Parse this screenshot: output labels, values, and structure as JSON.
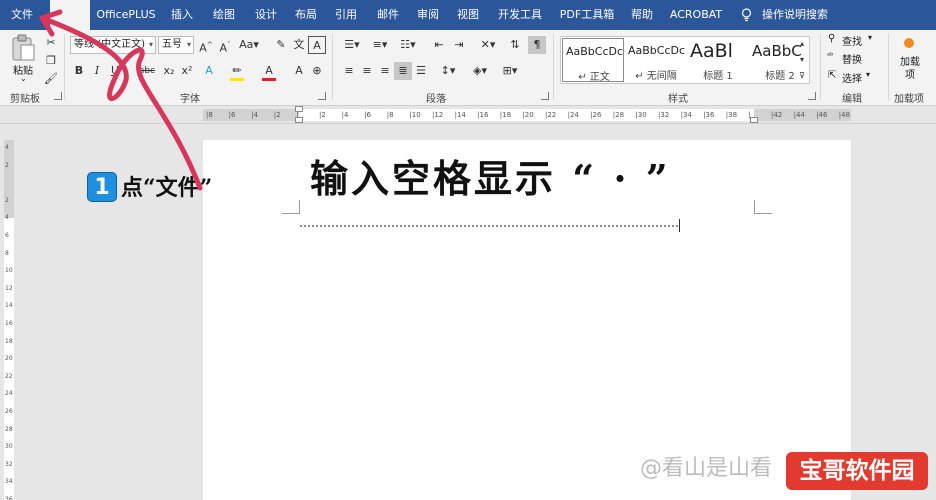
{
  "ribbon_tabs": [
    "文件",
    "",
    "OfficePLUS",
    "插入",
    "绘图",
    "设计",
    "布局",
    "引用",
    "邮件",
    "审阅",
    "视图",
    "开发工具",
    "PDF工具箱",
    "帮助",
    "ACROBAT",
    "操作说明搜索"
  ],
  "clipboard": {
    "paste_label": "粘贴",
    "group_label": "剪贴板"
  },
  "font": {
    "font_name": "等线 (中文正文)",
    "font_size": "五号",
    "group_label": "字体",
    "buttons": [
      "B",
      "I",
      "U",
      "abc",
      "x₂",
      "x²",
      "A",
      "A"
    ]
  },
  "paragraph": {
    "group_label": "段落"
  },
  "styles": {
    "group_label": "样式",
    "items": [
      {
        "sample": "AaBbCcDc",
        "name": "↵ 正文"
      },
      {
        "sample": "AaBbCcDc",
        "name": "↵ 无间隔"
      },
      {
        "sample": "AaBl",
        "name": "标题 1"
      },
      {
        "sample": "AaBbC",
        "name": "标题 2"
      }
    ]
  },
  "editing": {
    "find": "查找",
    "replace": "替换",
    "select": "选择",
    "group_label": "编辑"
  },
  "addins": {
    "label": "加载项",
    "group_label": "加载项"
  },
  "ruler": {
    "h_ticks": [
      "8",
      "6",
      "4",
      "2",
      "",
      "2",
      "4",
      "6",
      "8",
      "10",
      "12",
      "14",
      "16",
      "18",
      "20",
      "22",
      "24",
      "26",
      "28",
      "30",
      "32",
      "34",
      "36",
      "38",
      "",
      "42",
      "44",
      "46",
      "48"
    ],
    "v_ticks": [
      "4",
      "2",
      "",
      "2",
      "4",
      "6",
      "8",
      "10",
      "12",
      "14",
      "16",
      "18",
      "20",
      "22",
      "24",
      "26",
      "28",
      "30",
      "32",
      "34",
      "36"
    ]
  },
  "annotation": {
    "headline": "输入空格显示 “ · ”",
    "step_badge": "1",
    "step_text": "点“文件”"
  },
  "watermark": {
    "text": "@看山是山看",
    "badge": "宝哥软件园"
  }
}
